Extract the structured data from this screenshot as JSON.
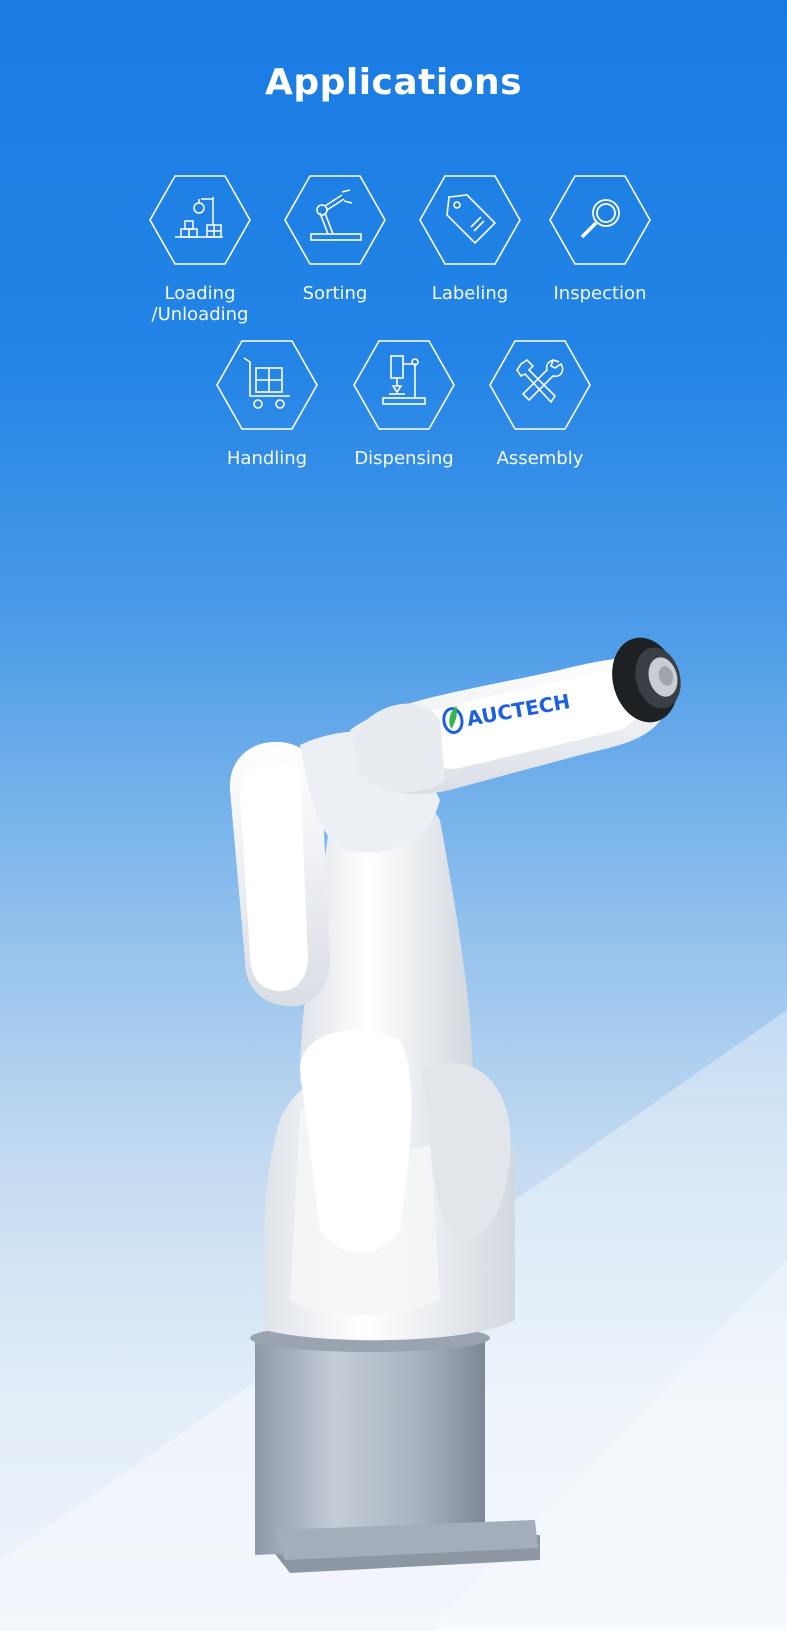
{
  "title": "Applications",
  "applications": [
    {
      "label": "Loading /Unloading",
      "icon": "loading-unloading-icon"
    },
    {
      "label": "Sorting",
      "icon": "robot-arm-icon"
    },
    {
      "label": "Labeling",
      "icon": "tag-icon"
    },
    {
      "label": "Inspection",
      "icon": "magnifier-icon"
    },
    {
      "label": "Handling",
      "icon": "cart-icon"
    },
    {
      "label": "Dispensing",
      "icon": "dispenser-icon"
    },
    {
      "label": "Assembly",
      "icon": "tools-icon"
    }
  ],
  "robot": {
    "brand": "AUCTECH",
    "logo_color": "#1c5fe0",
    "logo_leaf_color": "#2fb84a"
  },
  "colors": {
    "background_top": "#1a7be3",
    "background_bottom": "#edf3fa",
    "text": "#ffffff"
  }
}
